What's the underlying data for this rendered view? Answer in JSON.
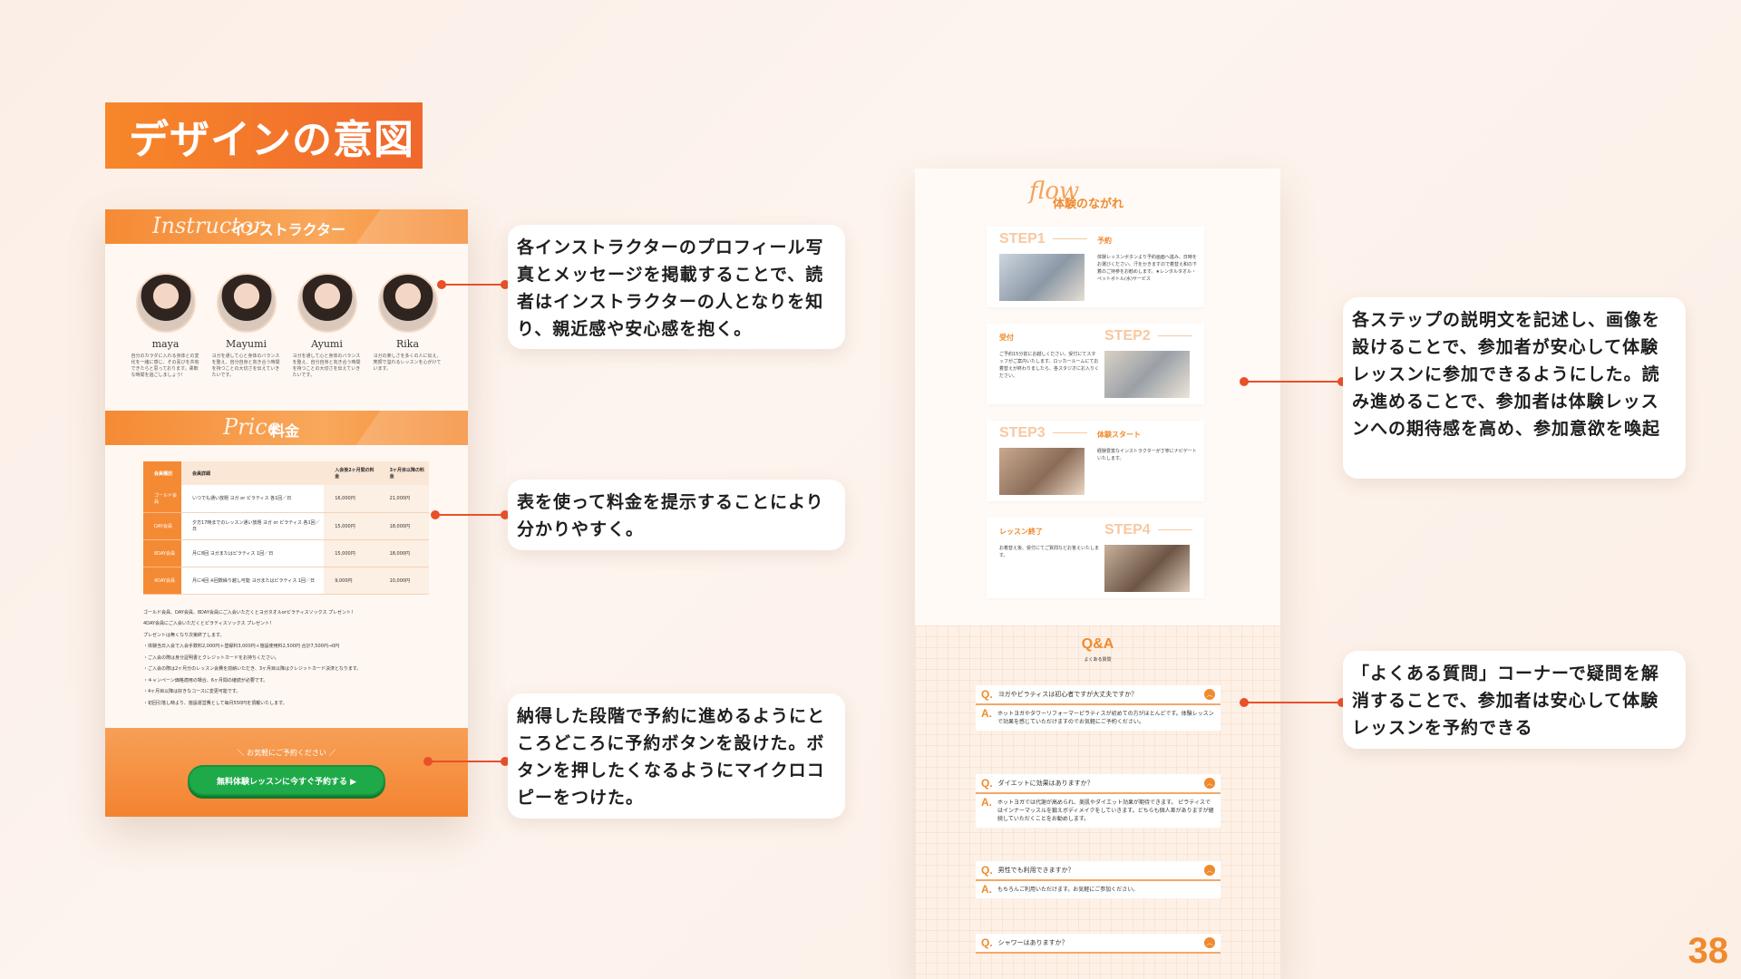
{
  "slide": {
    "title": "デザインの意図",
    "page_number": "38"
  },
  "left_mock": {
    "instructor_section": {
      "script_text": "Instructor",
      "heading": "インストラクター",
      "instructors": [
        {
          "name": "maya",
          "message": "自分のカラダに入れる身体との変化を一緒に感じ、その喜びを共有できたらと思っております。柔軟な時間を過ごしましょう！"
        },
        {
          "name": "Mayumi",
          "message": "ヨガを通して心と身体のバランスを整え、自分自身と向き合う時間を持つことの大切さを伝えていきたいです。"
        },
        {
          "name": "Ayumi",
          "message": "ヨガを通して心と身体のバランスを整え、自分自身と向き合う時間を持つことの大切さを伝えていきたいです。"
        },
        {
          "name": "Rika",
          "message": "ヨガの楽しさを多くの人に伝え、笑顔で溢れるレッスンを心がけています。"
        }
      ]
    },
    "price_section": {
      "script_text": "Price",
      "heading": "料金",
      "table_headers": [
        "会員種別",
        "会員詳細",
        "入会後2ヶ月間の料金",
        "3ヶ月目以降の料金"
      ],
      "rows": [
        {
          "type": "ゴールド会員",
          "detail": "いつでも通い放題 ヨガ or ピラティス 各1回／日",
          "first": "16,000円",
          "later": "21,000円"
        },
        {
          "type": "DAY会員",
          "detail": "夕方17時までのレッスン通い放題 ヨガ or ピラティス 各1回／日",
          "first": "15,000円",
          "later": "18,000円"
        },
        {
          "type": "8DAY会員",
          "detail": "月に8回 ヨガまたはピラティス 1回／日",
          "first": "15,000円",
          "later": "18,000円"
        },
        {
          "type": "4DAY会員",
          "detail": "月に4回 ※回数繰り越し可能 ヨガまたはピラティス 1回／日",
          "first": "9,000円",
          "later": "10,000円"
        }
      ],
      "notes": [
        "ゴールド会員、DAY会員、8DAY会員にご入会いただくとヨガタオルorピラティスソックス プレゼント！",
        "4DAY会員にご入会いただくとピラティスソックス プレゼント！",
        "プレゼントは無くなり次第終了します。",
        "・体験当日入会で入会手数料2,000円＋登録料3,000円＋施設使用料2,500円 合計7,500円→0円",
        "・ご入会の際は身分証明書とクレジットカードをお持ちください。",
        "・ご入会の際は2ヶ月分のレッスン会費を前納いただき、3ヶ月目以降はクレジットカード決済となります。",
        "・キャンペーン価格適用の場合、6ヶ月間の継続が必要です。",
        "・4ヶ月目以降は好きなコースに変更可能です。",
        "・初回引落し時より、施設運営費として毎月550円を頂戴いたします。"
      ]
    },
    "cta": {
      "micro_copy": "＼ お気軽にご予約ください ／",
      "button_label": "無料体験レッスンに今すぐ予約する ▶"
    }
  },
  "right_mock": {
    "flow_section": {
      "script_text": "flow",
      "heading": "体験のながれ",
      "steps": [
        {
          "label": "STEP1",
          "title": "予約",
          "desc": "体験レッスンボタンより予約画面へ進み、日時をお選びください。汗をかきますので着替え和の下着のご持参をお勧めします。★レンタルタオル・ペットボトル(水)サービス"
        },
        {
          "label": "STEP2",
          "title": "受付",
          "desc": "ご予約15分前にお越しください。受付にてスタッフがご案内いたします。ロッカールームにてお着替えが終わりましたら、各スタジオにお入りください。"
        },
        {
          "label": "STEP3",
          "title": "体験スタート",
          "desc": "経験豊富なインストラクターが丁寧にナビゲートいたします。"
        },
        {
          "label": "STEP4",
          "title": "レッスン終了",
          "desc": "お着替え後、受付にてご質問などお答えいたします。"
        }
      ]
    },
    "qa_section": {
      "title": "Q&A",
      "subtitle": "よくある質問",
      "items": [
        {
          "q": "ヨガやピラティスは初心者ですが大丈夫ですか？",
          "a": "ホットヨガやタワーリフォーマーピラティスが初めての方がほとんどです。体験レッスンで効果を感じていただけますのでお気軽にご予約ください。"
        },
        {
          "q": "ダイエットに効果はありますか？",
          "a": "ホットヨガでは代謝が高められ、美肌やダイエット効果が期待できます。 ピラティスではインナーマッスルを鍛えボディメイクをしていきます。どちらも個人差がありますが継続していただくことをお勧めします。"
        },
        {
          "q": "男性でも利用できますか？",
          "a": "もちろんご利用いただけます。お気軽にご参加ください。"
        },
        {
          "q": "シャワーはありますか？",
          "a": ""
        }
      ]
    }
  },
  "callouts": [
    {
      "id": "instructor",
      "text": "各インストラクターのプロフィール写真とメッセージを掲載することで、読者はインストラクターの人となりを知り、親近感や安心感を抱く。"
    },
    {
      "id": "price",
      "text": "表を使って料金を提示することにより分かりやすく。"
    },
    {
      "id": "cta",
      "text": "納得した段階で予約に進めるようにところどころに予約ボタンを設けた。ボタンを押したくなるようにマイクロコピーをつけた。"
    },
    {
      "id": "flow",
      "text": "各ステップの説明文を記述し、画像を設けることで、参加者が安心して体験レッスンに参加できるようにした。読み進めることで、参加者は体験レッスンへの期待感を高め、参加意欲を喚起"
    },
    {
      "id": "qa",
      "text": "「よくある質問」コーナーで疑問を解消することで、参加者は安心して体験レッスンを予約できる"
    }
  ],
  "colors": {
    "accent_orange": "#f58a34",
    "connector_red": "#e8502a",
    "cta_green": "#1faa4a"
  }
}
